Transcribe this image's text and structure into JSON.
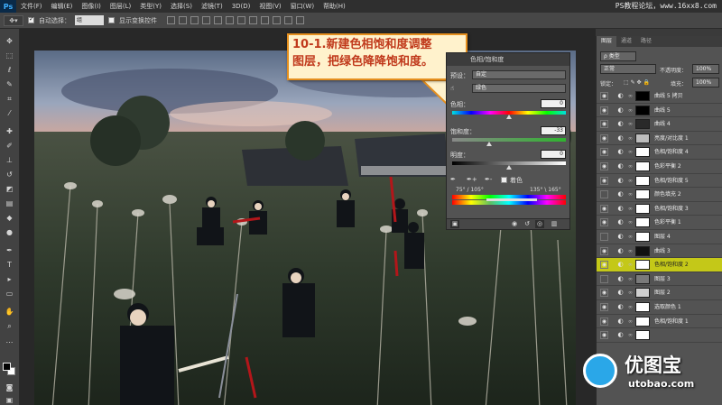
{
  "app": {
    "logo": "Ps"
  },
  "menu": [
    "文件(F)",
    "编辑(E)",
    "图像(I)",
    "图层(L)",
    "类型(Y)",
    "选择(S)",
    "滤镜(T)",
    "3D(D)",
    "视图(V)",
    "窗口(W)",
    "帮助(H)"
  ],
  "watermark_top": "PS教程论坛，www.16xx8.com",
  "options": {
    "auto_select_label": "自动选择：",
    "auto_select_value": "组",
    "show_transform_label": "显示变换控件"
  },
  "callout": {
    "line1": "10-1.新建色相饱和度调整",
    "line2": "图层，把绿色降降饱和度。"
  },
  "properties": {
    "title": "色相/饱和度",
    "preset_label": "预设：",
    "preset_value": "自定",
    "channel_value": "绿色",
    "hue_label": "色相：",
    "hue_value": "0",
    "saturation_label": "饱和度：",
    "saturation_value": "-33",
    "lightness_label": "明度：",
    "lightness_value": "0",
    "colorize_label": "着色",
    "range_left": "75° / 105°",
    "range_right": "135° \\ 165°"
  },
  "layers_panel": {
    "tabs": [
      "图层",
      "通道",
      "路径"
    ],
    "kind_filter": "ρ 类型",
    "blend_mode": "正常",
    "opacity_label": "不透明度：",
    "opacity_value": "100%",
    "lock_label": "锁定：",
    "fill_label": "填充：",
    "fill_value": "100%",
    "layers": [
      {
        "name": "曲线 5 拷贝",
        "visible": true,
        "mask": "#000000",
        "selected": false
      },
      {
        "name": "曲线 5",
        "visible": true,
        "mask": "#000000",
        "selected": false
      },
      {
        "name": "曲线 4",
        "visible": true,
        "mask": "#2a2a2a",
        "selected": false
      },
      {
        "name": "亮度/对比度 1",
        "visible": true,
        "mask": "#bdbdbd",
        "selected": false
      },
      {
        "name": "色相/饱和度 4",
        "visible": true,
        "mask": "#ffffff",
        "selected": false
      },
      {
        "name": "色彩平衡 2",
        "visible": true,
        "mask": "#ffffff",
        "selected": false
      },
      {
        "name": "色相/饱和度 5",
        "visible": true,
        "mask": "#ffffff",
        "selected": false
      },
      {
        "name": "颜色填充 2",
        "visible": false,
        "mask": "#ffffff",
        "selected": false
      },
      {
        "name": "色相/饱和度 3",
        "visible": true,
        "mask": "#ffffff",
        "selected": false
      },
      {
        "name": "色彩平衡 1",
        "visible": true,
        "mask": "#ffffff",
        "selected": false
      },
      {
        "name": "图层 4",
        "visible": false,
        "mask": "#ffffff",
        "selected": false
      },
      {
        "name": "曲线 3",
        "visible": true,
        "mask": "#111111",
        "selected": false
      },
      {
        "name": "色相/饱和度 2",
        "visible": true,
        "mask": "#ffffff",
        "selected": true
      },
      {
        "name": "图层 3",
        "visible": false,
        "mask": "#7a7a7a",
        "selected": false
      },
      {
        "name": "图层 2",
        "visible": true,
        "mask": "#cfcfcf",
        "selected": false
      },
      {
        "name": "选取颜色 1",
        "visible": true,
        "mask": "#ffffff",
        "selected": false
      },
      {
        "name": "色相/饱和度 1",
        "visible": true,
        "mask": "#ffffff",
        "selected": false
      },
      {
        "name": "",
        "visible": true,
        "mask": "#ffffff",
        "selected": false
      }
    ]
  },
  "brand_logo": {
    "cn": "优图宝",
    "en": "utobao.com"
  },
  "colors": {
    "callout_border": "#e58f1e",
    "callout_bg": "#fff2cc",
    "callout_text": "#c0391b",
    "selected_layer": "#c4c818"
  }
}
